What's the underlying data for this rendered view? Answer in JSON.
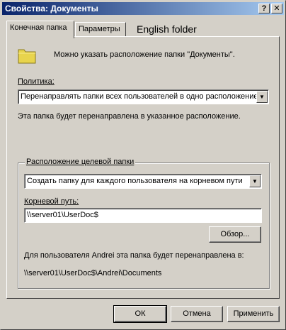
{
  "window": {
    "title": "Свойства: Документы",
    "help_glyph": "?",
    "close_glyph": "✕"
  },
  "tabs": [
    {
      "label": "Конечная папка"
    },
    {
      "label": "Параметры"
    },
    {
      "label": "English folder"
    }
  ],
  "main": {
    "folder_description": "Можно указать расположение папки \"Документы\".",
    "policy_label": "Политика:",
    "policy_value": "Перенаправлять папки всех пользователей в одно расположение",
    "policy_note": "Эта папка будет перенаправлена в указанное расположение."
  },
  "target_group": {
    "legend": "Расположение целевой папки",
    "location_value": "Создать папку для каждого пользователя на корневом пути",
    "root_path_label": "Корневой путь:",
    "root_path_value": "\\\\server01\\UserDoc$",
    "browse_label": "Обзор...",
    "user_note": "Для пользователя Andrei эта папка будет перенаправлена в:",
    "resolved_path": "\\\\server01\\UserDoc$\\Andrei\\Documents"
  },
  "footer": {
    "ok_label": "ОК",
    "cancel_label": "Отмена",
    "apply_label": "Применить"
  },
  "icons": {
    "folder": "folder-icon",
    "dropdown": "chevron-down-icon"
  },
  "colors": {
    "titlebar_start": "#0a246a",
    "titlebar_end": "#a6caf0",
    "dialog_bg": "#d4d0c8",
    "folder_yellow": "#e8d44d"
  }
}
